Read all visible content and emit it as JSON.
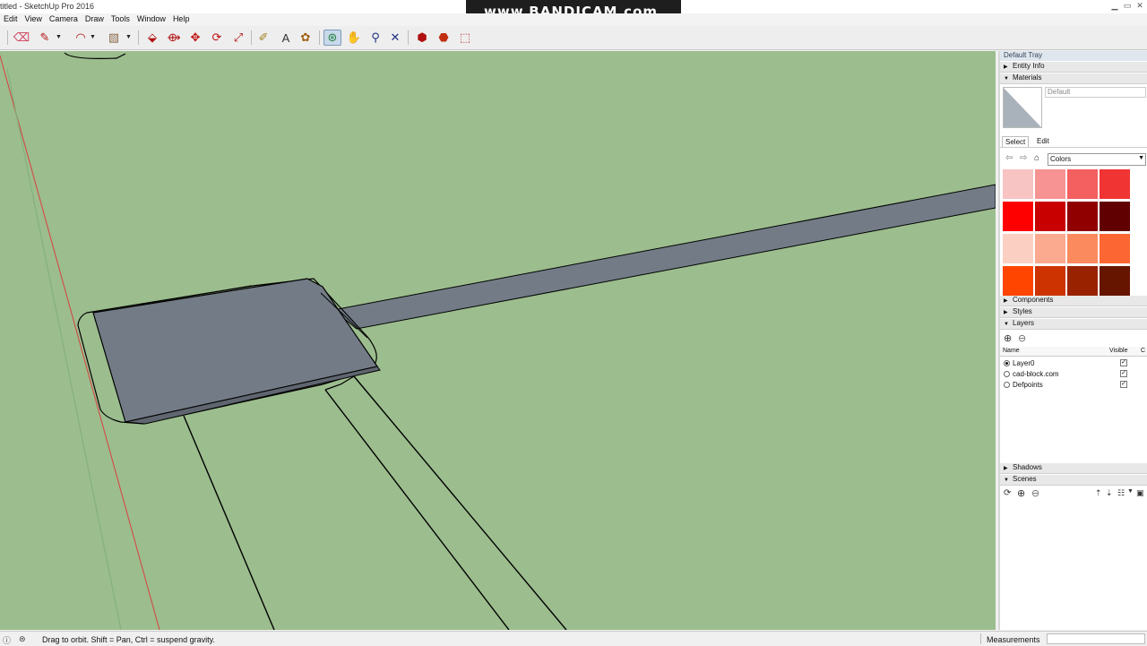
{
  "window": {
    "title": "titled - SketchUp Pro 2016",
    "watermark": "www.BANDICAM.com"
  },
  "menu": [
    "Edit",
    "View",
    "Camera",
    "Draw",
    "Tools",
    "Window",
    "Help"
  ],
  "toolbar": {
    "tools": [
      {
        "name": "eraser-tool",
        "icon": "eraser-icon",
        "glyph": "⌫",
        "color": "#d0405c"
      },
      {
        "name": "pencil-tool",
        "icon": "pencil-icon",
        "glyph": "✎",
        "color": "#b01010"
      },
      {
        "name": "arc-tool",
        "icon": "arc-icon",
        "glyph": "◠",
        "color": "#b01010"
      },
      {
        "name": "rectangle-tool",
        "icon": "rectangle-icon",
        "glyph": "▧",
        "color": "#8a6a4a"
      },
      {
        "name": "push-pull-tool",
        "icon": "push-pull-icon",
        "glyph": "⬙",
        "color": "#b01010"
      },
      {
        "name": "follow-me-tool",
        "icon": "follow-me-icon",
        "glyph": "⟴",
        "color": "#b01010"
      },
      {
        "name": "move-tool",
        "icon": "move-icon",
        "glyph": "✥",
        "color": "#c01010"
      },
      {
        "name": "rotate-tool",
        "icon": "rotate-icon",
        "glyph": "⟳",
        "color": "#c01010"
      },
      {
        "name": "scale-tool",
        "icon": "scale-icon",
        "glyph": "⤢",
        "color": "#b01010"
      },
      {
        "name": "tape-measure-tool",
        "icon": "tape-measure-icon",
        "glyph": "✐",
        "color": "#a08020"
      },
      {
        "name": "text-tool",
        "icon": "text-icon",
        "glyph": "A",
        "color": "#333333"
      },
      {
        "name": "paint-bucket-tool",
        "icon": "paint-bucket-icon",
        "glyph": "✿",
        "color": "#a06010"
      },
      {
        "name": "orbit-tool",
        "icon": "orbit-icon",
        "glyph": "⊛",
        "color": "#208040"
      },
      {
        "name": "pan-tool",
        "icon": "pan-icon",
        "glyph": "✋",
        "color": "#c08030"
      },
      {
        "name": "zoom-tool",
        "icon": "zoom-icon",
        "glyph": "⚲",
        "color": "#203080"
      },
      {
        "name": "zoom-extents-tool",
        "icon": "zoom-extents-icon",
        "glyph": "✕",
        "color": "#203080"
      },
      {
        "name": "warehouse-tool",
        "icon": "warehouse-icon",
        "glyph": "⬢",
        "color": "#b01010"
      },
      {
        "name": "extension-warehouse-tool",
        "icon": "extension-warehouse-icon",
        "glyph": "⬣",
        "color": "#c03010"
      },
      {
        "name": "share-model-tool",
        "icon": "share-model-icon",
        "glyph": "⬚",
        "color": "#c03030"
      }
    ]
  },
  "tray": {
    "title": "Default Tray",
    "sections": {
      "entity_info": "Entity Info",
      "materials": "Materials",
      "components": "Components",
      "styles": "Styles",
      "layers": "Layers",
      "shadows": "Shadows",
      "scenes": "Scenes"
    },
    "materials": {
      "current_name": "Default",
      "tabs": [
        "Select",
        "Edit"
      ],
      "library": "Colors",
      "swatches": [
        "#f7c3c3",
        "#f79393",
        "#f45f5f",
        "#f03434",
        "#ff0000",
        "#c80000",
        "#900000",
        "#600000",
        "#fbd0c3",
        "#fba98f",
        "#fb8a5f",
        "#fb6633",
        "#ff4500",
        "#cc3300",
        "#992200",
        "#661500"
      ]
    },
    "layers": {
      "columns": [
        "Name",
        "Visible",
        "C"
      ],
      "rows": [
        {
          "name": "Layer0",
          "active": true,
          "visible": true
        },
        {
          "name": "cad-block.com",
          "active": false,
          "visible": true
        },
        {
          "name": "Defpoints",
          "active": false,
          "visible": true
        }
      ]
    }
  },
  "status": {
    "message": "Drag to orbit. Shift = Pan, Ctrl = suspend gravity.",
    "measurements_label": "Measurements"
  },
  "colors": {
    "viewport_bg": "#9cbd8e",
    "model_face": "#737c86",
    "edge": "#000000",
    "red_axis": "#d83c3c"
  }
}
